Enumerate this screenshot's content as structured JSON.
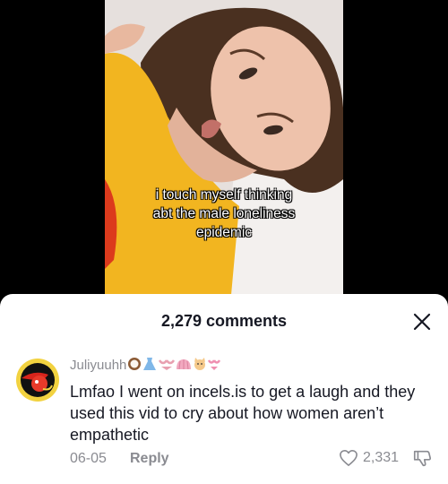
{
  "video": {
    "caption_lines": [
      "i touch myself thinking",
      "abt the male loneliness",
      "epidemic"
    ]
  },
  "comments_sheet": {
    "title": "2,279 comments",
    "close_icon": "close-icon"
  },
  "comment": {
    "username": "Juliyuuhh",
    "username_emojis": [
      "coconut",
      "dress",
      "bikini",
      "shell",
      "cat-face",
      "bikini"
    ],
    "text": "Lmfao I went on incels.is to get a laugh and they used this vid to cry about how women aren’t empathetic",
    "date": "06-05",
    "reply_label": "Reply",
    "like_count": "2,331",
    "like_icon": "heart-outline-icon",
    "dislike_icon": "thumbs-down-icon"
  },
  "colors": {
    "text_primary": "#161823",
    "text_secondary": "#8a8b91",
    "sheet_bg": "#ffffff",
    "video_bg": "#000000"
  }
}
